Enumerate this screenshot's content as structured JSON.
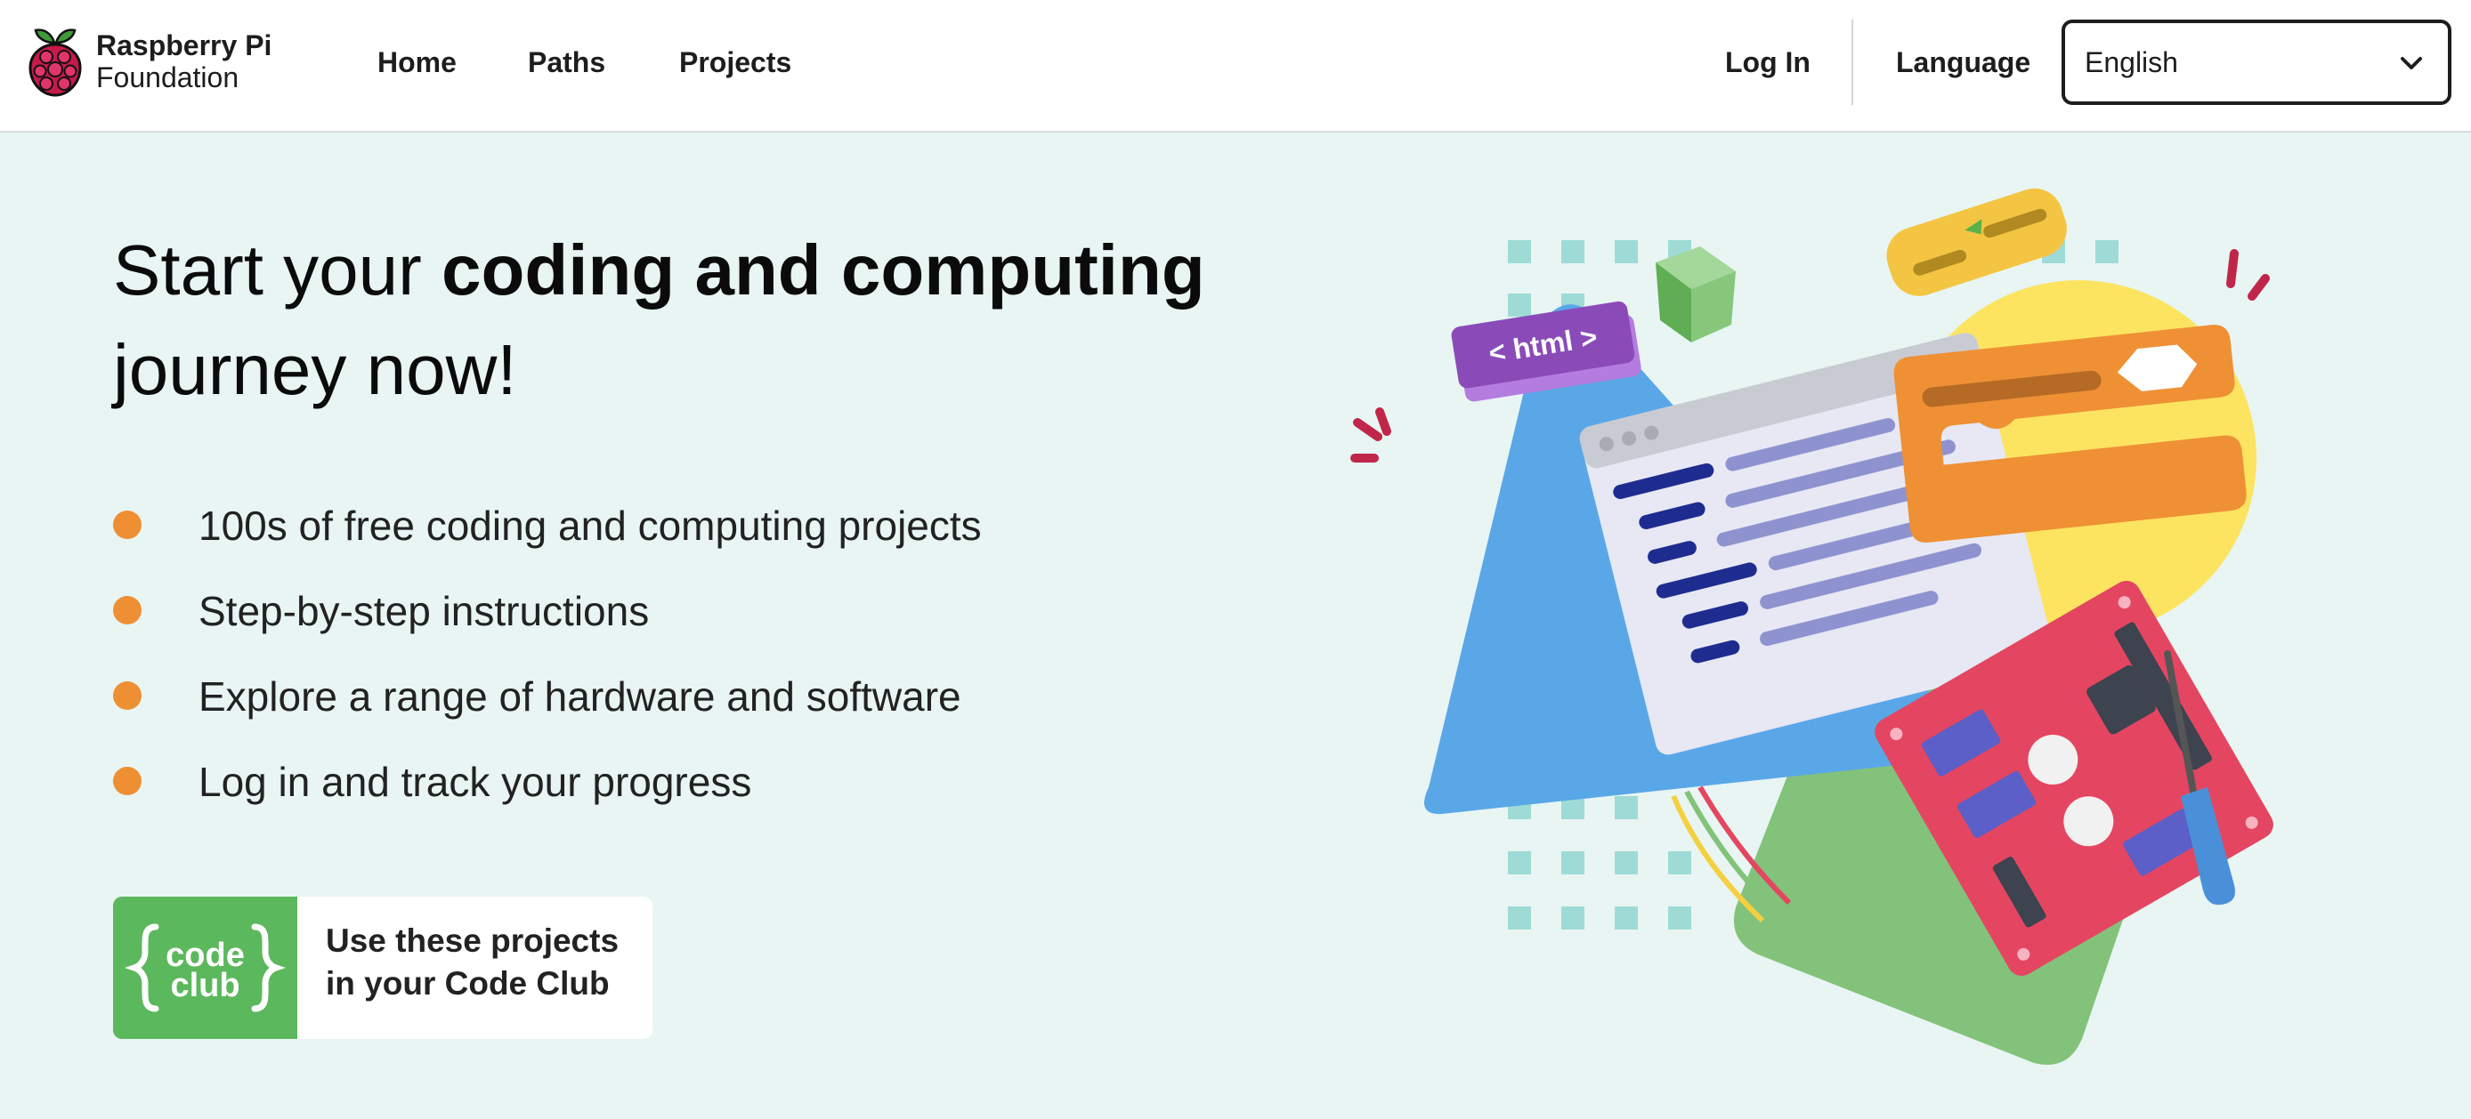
{
  "header": {
    "brand_line1": "Raspberry Pi",
    "brand_line2": "Foundation",
    "nav": [
      "Home",
      "Paths",
      "Projects"
    ],
    "login": "Log In",
    "language_label": "Language",
    "language_value": "English"
  },
  "hero": {
    "title_pre": "Start your ",
    "title_bold": "coding and computing",
    "title_post": " journey now!",
    "bullets": [
      "100s of free coding and computing projects",
      "Step-by-step instructions",
      "Explore a range of hardware and software",
      "Log in and track your progress"
    ],
    "cta_logo_line1": "code",
    "cta_logo_line2": "club",
    "cta_line1": "Use these projects",
    "cta_line2": "in your Code Club",
    "illustration_html_tag": "< html >"
  },
  "colors": {
    "hero_bg": "#e8f5f3",
    "bullet": "#ef8f33",
    "code_club_green": "#5cb85c",
    "raspberry": "#c51a4a"
  },
  "icons": [
    "raspberry-pi-logo-icon",
    "chevron-down-icon",
    "bullet-dot-icon",
    "code-club-logo-icon"
  ]
}
